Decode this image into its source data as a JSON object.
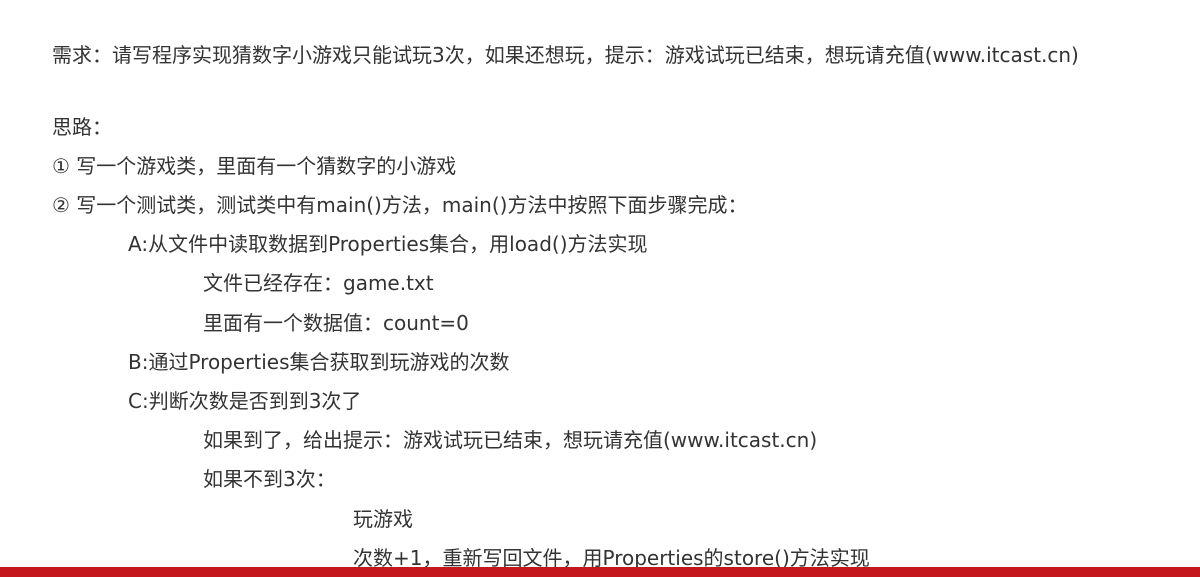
{
  "document": {
    "requirement": "需求：请写程序实现猜数字小游戏只能试玩3次，如果还想玩，提示：游戏试玩已结束，想玩请充值(www.itcast.cn)",
    "idea_heading": "思路：",
    "steps": [
      "① 写一个游戏类，里面有一个猜数字的小游戏",
      "② 写一个测试类，测试类中有main()方法，main()方法中按照下面步骤完成："
    ],
    "substeps": {
      "a": "A:从文件中读取数据到Properties集合，用load()方法实现",
      "a_file": "文件已经存在：game.txt",
      "a_value": "里面有一个数据值：count=0",
      "b": "B:通过Properties集合获取到玩游戏的次数",
      "c": "C:判断次数是否到到3次了",
      "c_yes": "如果到了，给出提示：游戏试玩已结束，想玩请充值(www.itcast.cn)",
      "c_no": "如果不到3次：",
      "c_no_play": "玩游戏",
      "c_no_count": "次数+1，重新写回文件，用Properties的store()方法实现"
    }
  },
  "colors": {
    "text": "#333333",
    "background": "#ffffff",
    "bottom_bar": "#c4171d"
  }
}
